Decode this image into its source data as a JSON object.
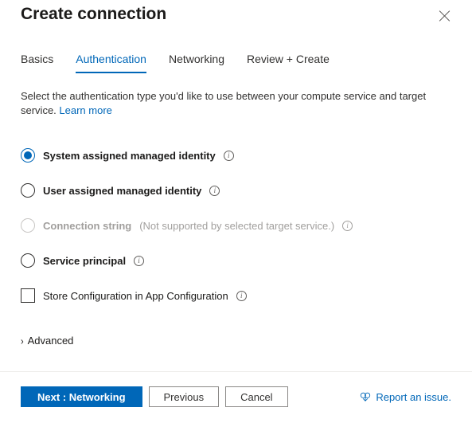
{
  "header": {
    "title": "Create connection"
  },
  "tabs": [
    "Basics",
    "Authentication",
    "Networking",
    "Review + Create"
  ],
  "active_tab": 1,
  "description": {
    "text": "Select the authentication type you'd like to use between your compute service and target service. ",
    "link": "Learn more"
  },
  "auth_options": [
    {
      "label": "System assigned managed identity",
      "selected": true,
      "disabled": false,
      "hint": ""
    },
    {
      "label": "User assigned managed identity",
      "selected": false,
      "disabled": false,
      "hint": ""
    },
    {
      "label": "Connection string",
      "selected": false,
      "disabled": true,
      "hint": "(Not supported by selected target service.)"
    },
    {
      "label": "Service principal",
      "selected": false,
      "disabled": false,
      "hint": ""
    }
  ],
  "store_config": {
    "label": "Store Configuration in App Configuration",
    "checked": false
  },
  "advanced_label": "Advanced",
  "footer": {
    "next": "Next : Networking",
    "previous": "Previous",
    "cancel": "Cancel",
    "report": "Report an issue."
  }
}
